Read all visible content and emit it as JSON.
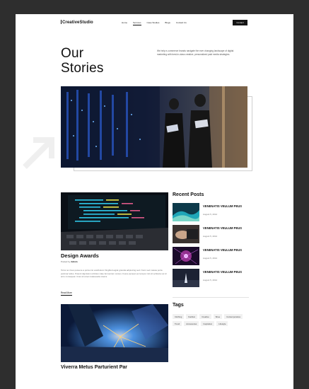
{
  "brand": {
    "logo_text": "CreativeStudio"
  },
  "nav": {
    "items": [
      "Home",
      "Services",
      "Case Studies",
      "Blogs",
      "Contact Us"
    ],
    "active_index": 1,
    "cta_label": "Contact"
  },
  "header": {
    "title_line1": "Our",
    "title_line2": "Stories",
    "intro": "We help e-commerce brands navigate the ever changing landscape of digital marketing with best-in-class creative, personalized paid media strategies."
  },
  "posts": [
    {
      "title": "Design Awards",
      "meta_prefix": "Posted by",
      "author": "Admin",
      "excerpt": "Tortor ac risus posuere a porta nisi vestibulum fringilla feugiat gravida adipiscing sed. Nunc sed massa porta pulvinar tellus. Potenti dignissim ultricies vitae fermentum cursus. Fusce aenean ac tempor nisl sit vehicula vel id arcu consequat. Cras sit amet malesuada viverra.",
      "read_more": "Read More"
    },
    {
      "title": "Viverra Metus Parturient Par"
    }
  ],
  "sidebar": {
    "recent_heading": "Recent Posts",
    "recent": [
      {
        "title": "VENENATIS VEULUM PEUS",
        "date": "August 5, 2012"
      },
      {
        "title": "VENENATIS VEULUM PEUS",
        "date": "August 5, 2012"
      },
      {
        "title": "VENENATIS VEULUM PEUS",
        "date": "August 5, 2012"
      },
      {
        "title": "VENENATIS VEULUM PEUS",
        "date": "August 5, 2012"
      }
    ],
    "tags_heading": "Tags",
    "tags": [
      "Clothing",
      "Fashion",
      "Creative",
      "Shoe",
      "Contemporaries",
      "Trend",
      "Accessories",
      "Inspiration",
      "Lifestyle"
    ]
  },
  "colors": {
    "accent": "#141414",
    "frame": "#2e2e2e"
  }
}
